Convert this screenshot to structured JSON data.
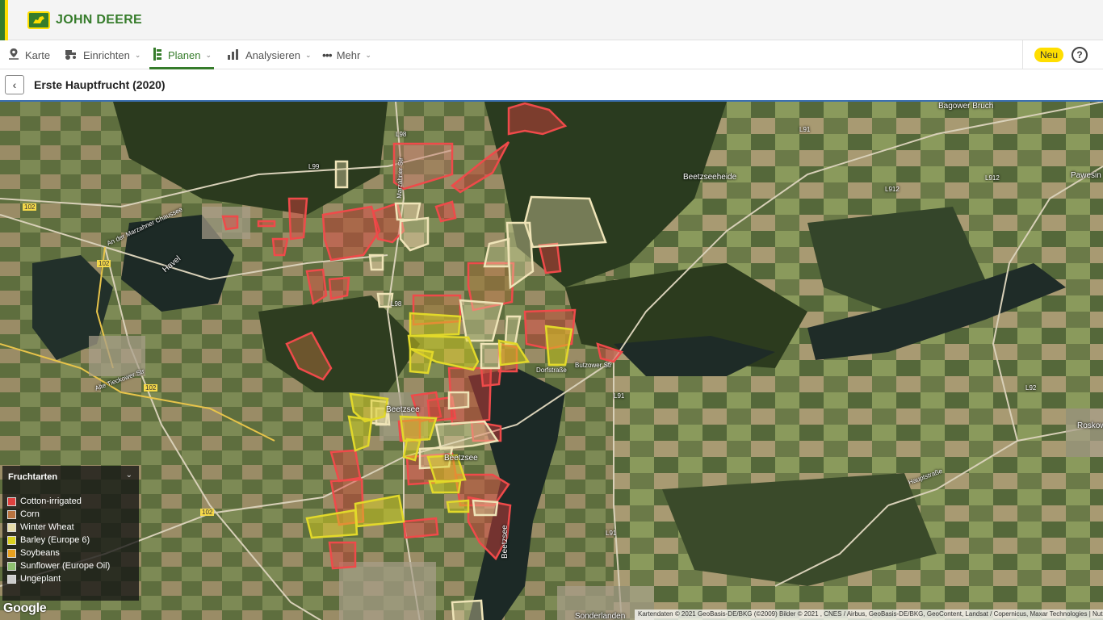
{
  "brand": {
    "name": "JOHN DEERE",
    "logo_icon": "deere-logo-icon"
  },
  "nav": {
    "items": [
      {
        "label": "Karte",
        "icon": "map-pin-icon",
        "has_menu": false
      },
      {
        "label": "Einrichten",
        "icon": "tractor-icon",
        "has_menu": true
      },
      {
        "label": "Planen",
        "icon": "planner-icon",
        "has_menu": true,
        "active": true
      },
      {
        "label": "Analysieren",
        "icon": "bar-chart-icon",
        "has_menu": true
      },
      {
        "label": "Mehr",
        "icon": "more-dots-icon",
        "has_menu": true
      }
    ],
    "badge": "Neu",
    "help": "?"
  },
  "page": {
    "back": "‹",
    "title": "Erste Hauptfrucht (2020)"
  },
  "map": {
    "labels": [
      "Bagower Bruch",
      "Beetzseeheide",
      "Pawesin",
      "Havel",
      "Beetzsee",
      "Beetzsee",
      "Beetzsee",
      "Sonderlanden",
      "Roskow",
      "Dorfstraße",
      "Butzower Str",
      "Hauptstraße",
      "Alte Tieckower Str",
      "An der Marzahner Chaussee",
      "Marzahner Str",
      "102",
      "102",
      "102",
      "102",
      "L91",
      "L91",
      "L91",
      "L912",
      "L912",
      "L98",
      "L98",
      "L99",
      "L92"
    ],
    "colors": {
      "cotton": "#e0413f",
      "corn": "#b8733f",
      "winter_wheat": "#e6dcaa",
      "barley": "#d9d020",
      "soybeans": "#e8a020",
      "sunflower": "#8fbf70",
      "ungeplant": "#cccccc"
    }
  },
  "legend": {
    "title": "Fruchtarten",
    "items": [
      {
        "label": "Cotton-irrigated",
        "color": "#e0413f",
        "checked": true
      },
      {
        "label": "Corn",
        "color": "#b8733f",
        "checked": false
      },
      {
        "label": "Winter Wheat",
        "color": "#e6dcaa",
        "checked": false
      },
      {
        "label": "Barley (Europe 6)",
        "color": "#d9d020",
        "checked": true
      },
      {
        "label": "Soybeans",
        "color": "#e8a020",
        "checked": false
      },
      {
        "label": "Sunflower (Europe Oil)",
        "color": "#8fbf70",
        "checked": false
      },
      {
        "label": "Ungeplant",
        "color": "#cccccc",
        "checked": false
      }
    ]
  },
  "google": "Google",
  "attribution": "Kartendaten © 2021 GeoBasis-DE/BKG (©2009) Bilder © 2021 , CNES / Airbus, GeoBasis-DE/BKG, GeoContent, Landsat / Copernicus, Maxar Technologies | Nutz"
}
